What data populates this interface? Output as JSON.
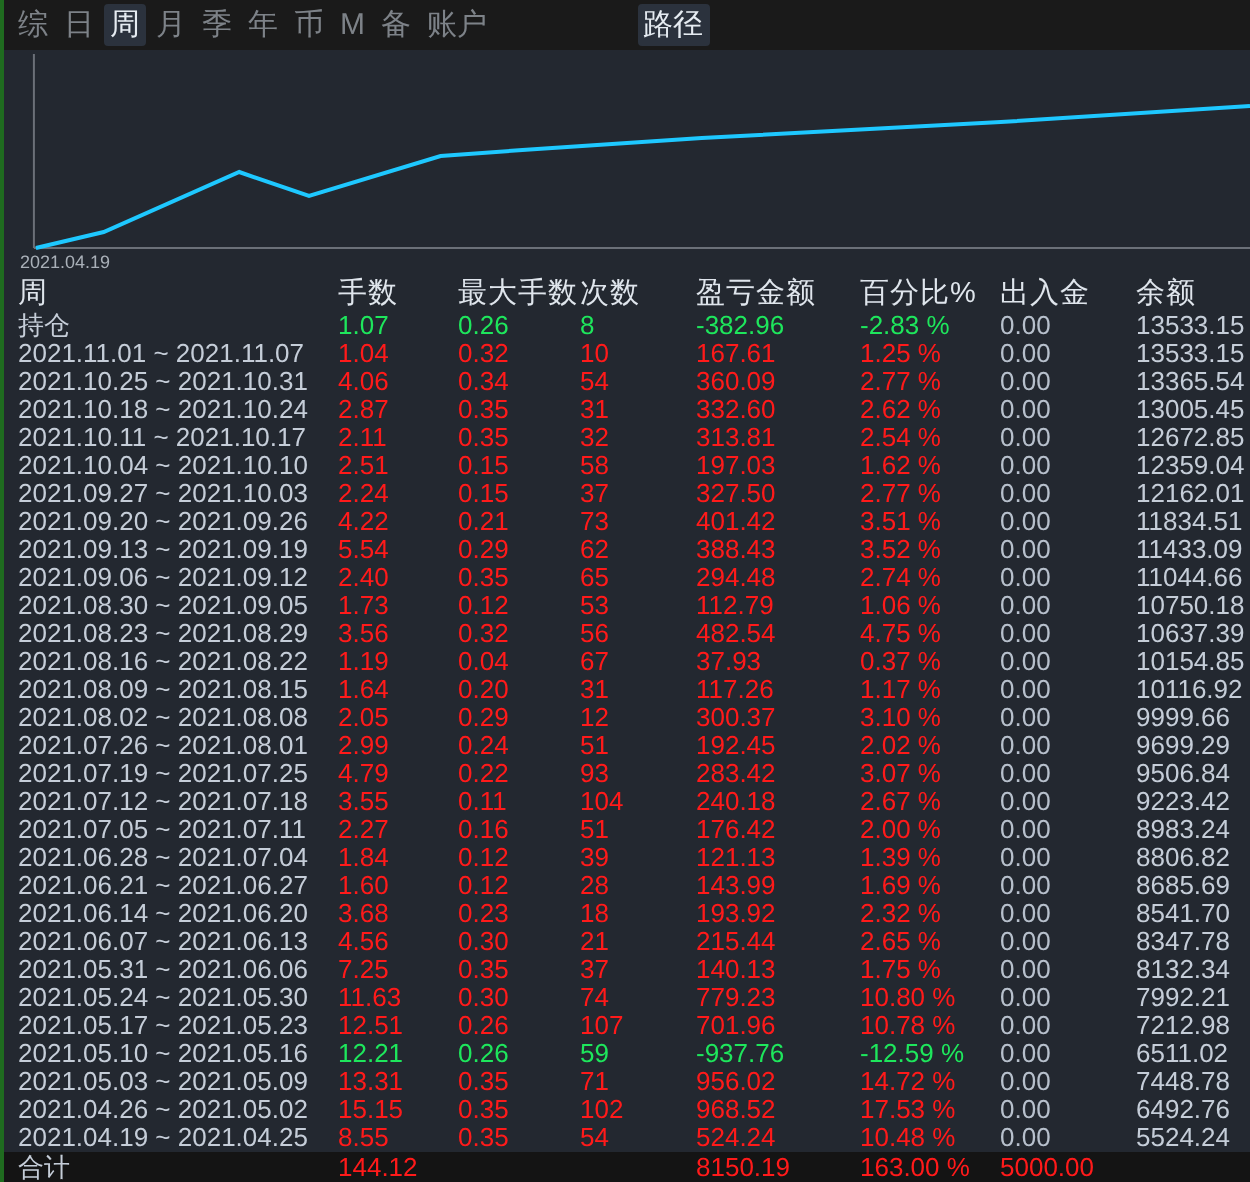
{
  "tabs": [
    {
      "label": "综",
      "selected": false
    },
    {
      "label": "日",
      "selected": false
    },
    {
      "label": "周",
      "selected": true
    },
    {
      "label": "月",
      "selected": false
    },
    {
      "label": "季",
      "selected": false
    },
    {
      "label": "年",
      "selected": false
    },
    {
      "label": "币",
      "selected": false
    },
    {
      "label": "M",
      "selected": false
    },
    {
      "label": "备",
      "selected": false
    },
    {
      "label": "账户",
      "selected": false
    }
  ],
  "path_button": "路径",
  "chart": {
    "start_label": "2021.04.19"
  },
  "table": {
    "columns": [
      "周",
      "手数",
      "最大手数",
      "次数",
      "盈亏金额",
      "百分比%",
      "出入金",
      "余额"
    ],
    "rows": [
      {
        "kind": "loss",
        "cells": [
          "持仓",
          "1.07",
          "0.26",
          "8",
          "-382.96",
          "-2.83 %",
          "0.00",
          "13533.15"
        ]
      },
      {
        "kind": "gain",
        "cells": [
          "2021.11.01 ~ 2021.11.07",
          "1.04",
          "0.32",
          "10",
          "167.61",
          "1.25 %",
          "0.00",
          "13533.15"
        ]
      },
      {
        "kind": "gain",
        "cells": [
          "2021.10.25 ~ 2021.10.31",
          "4.06",
          "0.34",
          "54",
          "360.09",
          "2.77 %",
          "0.00",
          "13365.54"
        ]
      },
      {
        "kind": "gain",
        "cells": [
          "2021.10.18 ~ 2021.10.24",
          "2.87",
          "0.35",
          "31",
          "332.60",
          "2.62 %",
          "0.00",
          "13005.45"
        ]
      },
      {
        "kind": "gain",
        "cells": [
          "2021.10.11 ~ 2021.10.17",
          "2.11",
          "0.35",
          "32",
          "313.81",
          "2.54 %",
          "0.00",
          "12672.85"
        ]
      },
      {
        "kind": "gain",
        "cells": [
          "2021.10.04 ~ 2021.10.10",
          "2.51",
          "0.15",
          "58",
          "197.03",
          "1.62 %",
          "0.00",
          "12359.04"
        ]
      },
      {
        "kind": "gain",
        "cells": [
          "2021.09.27 ~ 2021.10.03",
          "2.24",
          "0.15",
          "37",
          "327.50",
          "2.77 %",
          "0.00",
          "12162.01"
        ]
      },
      {
        "kind": "gain",
        "cells": [
          "2021.09.20 ~ 2021.09.26",
          "4.22",
          "0.21",
          "73",
          "401.42",
          "3.51 %",
          "0.00",
          "11834.51"
        ]
      },
      {
        "kind": "gain",
        "cells": [
          "2021.09.13 ~ 2021.09.19",
          "5.54",
          "0.29",
          "62",
          "388.43",
          "3.52 %",
          "0.00",
          "11433.09"
        ]
      },
      {
        "kind": "gain",
        "cells": [
          "2021.09.06 ~ 2021.09.12",
          "2.40",
          "0.35",
          "65",
          "294.48",
          "2.74 %",
          "0.00",
          "11044.66"
        ]
      },
      {
        "kind": "gain",
        "cells": [
          "2021.08.30 ~ 2021.09.05",
          "1.73",
          "0.12",
          "53",
          "112.79",
          "1.06 %",
          "0.00",
          "10750.18"
        ]
      },
      {
        "kind": "gain",
        "cells": [
          "2021.08.23 ~ 2021.08.29",
          "3.56",
          "0.32",
          "56",
          "482.54",
          "4.75 %",
          "0.00",
          "10637.39"
        ]
      },
      {
        "kind": "gain",
        "cells": [
          "2021.08.16 ~ 2021.08.22",
          "1.19",
          "0.04",
          "67",
          "37.93",
          "0.37 %",
          "0.00",
          "10154.85"
        ]
      },
      {
        "kind": "gain",
        "cells": [
          "2021.08.09 ~ 2021.08.15",
          "1.64",
          "0.20",
          "31",
          "117.26",
          "1.17 %",
          "0.00",
          "10116.92"
        ]
      },
      {
        "kind": "gain",
        "cells": [
          "2021.08.02 ~ 2021.08.08",
          "2.05",
          "0.29",
          "12",
          "300.37",
          "3.10 %",
          "0.00",
          "9999.66"
        ]
      },
      {
        "kind": "gain",
        "cells": [
          "2021.07.26 ~ 2021.08.01",
          "2.99",
          "0.24",
          "51",
          "192.45",
          "2.02 %",
          "0.00",
          "9699.29"
        ]
      },
      {
        "kind": "gain",
        "cells": [
          "2021.07.19 ~ 2021.07.25",
          "4.79",
          "0.22",
          "93",
          "283.42",
          "3.07 %",
          "0.00",
          "9506.84"
        ]
      },
      {
        "kind": "gain",
        "cells": [
          "2021.07.12 ~ 2021.07.18",
          "3.55",
          "0.11",
          "104",
          "240.18",
          "2.67 %",
          "0.00",
          "9223.42"
        ]
      },
      {
        "kind": "gain",
        "cells": [
          "2021.07.05 ~ 2021.07.11",
          "2.27",
          "0.16",
          "51",
          "176.42",
          "2.00 %",
          "0.00",
          "8983.24"
        ]
      },
      {
        "kind": "gain",
        "cells": [
          "2021.06.28 ~ 2021.07.04",
          "1.84",
          "0.12",
          "39",
          "121.13",
          "1.39 %",
          "0.00",
          "8806.82"
        ]
      },
      {
        "kind": "gain",
        "cells": [
          "2021.06.21 ~ 2021.06.27",
          "1.60",
          "0.12",
          "28",
          "143.99",
          "1.69 %",
          "0.00",
          "8685.69"
        ]
      },
      {
        "kind": "gain",
        "cells": [
          "2021.06.14 ~ 2021.06.20",
          "3.68",
          "0.23",
          "18",
          "193.92",
          "2.32 %",
          "0.00",
          "8541.70"
        ]
      },
      {
        "kind": "gain",
        "cells": [
          "2021.06.07 ~ 2021.06.13",
          "4.56",
          "0.30",
          "21",
          "215.44",
          "2.65 %",
          "0.00",
          "8347.78"
        ]
      },
      {
        "kind": "gain",
        "cells": [
          "2021.05.31 ~ 2021.06.06",
          "7.25",
          "0.35",
          "37",
          "140.13",
          "1.75 %",
          "0.00",
          "8132.34"
        ]
      },
      {
        "kind": "gain",
        "cells": [
          "2021.05.24 ~ 2021.05.30",
          "11.63",
          "0.30",
          "74",
          "779.23",
          "10.80 %",
          "0.00",
          "7992.21"
        ]
      },
      {
        "kind": "gain",
        "cells": [
          "2021.05.17 ~ 2021.05.23",
          "12.51",
          "0.26",
          "107",
          "701.96",
          "10.78 %",
          "0.00",
          "7212.98"
        ]
      },
      {
        "kind": "loss",
        "cells": [
          "2021.05.10 ~ 2021.05.16",
          "12.21",
          "0.26",
          "59",
          "-937.76",
          "-12.59 %",
          "0.00",
          "6511.02"
        ]
      },
      {
        "kind": "gain",
        "cells": [
          "2021.05.03 ~ 2021.05.09",
          "13.31",
          "0.35",
          "71",
          "956.02",
          "14.72 %",
          "0.00",
          "7448.78"
        ]
      },
      {
        "kind": "gain",
        "cells": [
          "2021.04.26 ~ 2021.05.02",
          "15.15",
          "0.35",
          "102",
          "968.52",
          "17.53 %",
          "0.00",
          "6492.76"
        ]
      },
      {
        "kind": "gain",
        "cells": [
          "2021.04.19 ~ 2021.04.25",
          "8.55",
          "0.35",
          "54",
          "524.24",
          "10.48 %",
          "0.00",
          "5524.24"
        ]
      }
    ],
    "total": {
      "label": "合计",
      "lots": "144.12",
      "profit": "8150.19",
      "percent": "163.00 %",
      "cash": "5000.00"
    }
  }
}
